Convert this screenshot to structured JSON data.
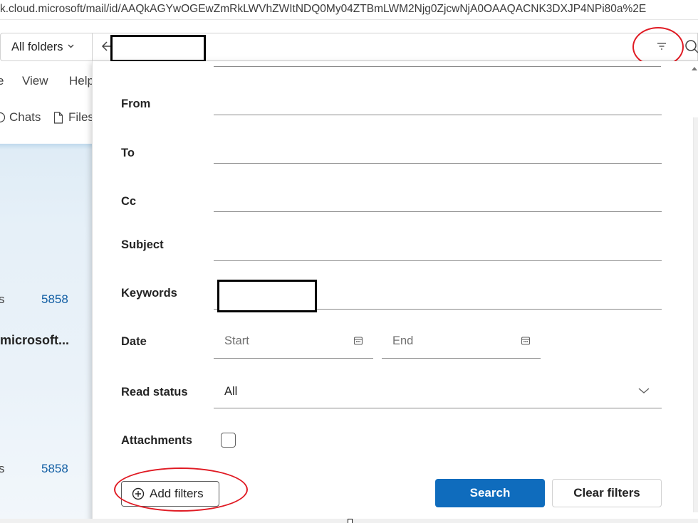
{
  "browser": {
    "url": "k.cloud.microsoft/mail/id/AAQkAGYwOGEwZmRkLWVhZWItNDQ0My04ZTBmLWM2Njg0ZjcwNjA0OAAQACNK3DXJP4NPi80a%2E"
  },
  "toolbar": {
    "folder_scope": "All folders"
  },
  "menu": {
    "items": [
      "e",
      "View",
      "Help"
    ]
  },
  "app_tabs": {
    "chats": "Chats",
    "files": "Files"
  },
  "mail_list": {
    "rows": [
      {
        "cut": "s",
        "count": "5858"
      },
      {
        "sender": "microsoft..."
      },
      {
        "cut": "s",
        "count": "5858"
      }
    ]
  },
  "filter_panel": {
    "fields": {
      "from": {
        "label": "From",
        "value": ""
      },
      "to": {
        "label": "To",
        "value": ""
      },
      "cc": {
        "label": "Cc",
        "value": ""
      },
      "subject": {
        "label": "Subject",
        "value": ""
      },
      "keywords": {
        "label": "Keywords",
        "value": ""
      },
      "date": {
        "label": "Date",
        "start_placeholder": "Start",
        "end_placeholder": "End"
      },
      "read_status": {
        "label": "Read status",
        "value": "All"
      },
      "attachments": {
        "label": "Attachments",
        "checked": false
      }
    },
    "buttons": {
      "add_filters": "Add filters",
      "search": "Search",
      "clear_filters": "Clear filters"
    }
  },
  "icons": {
    "back": "arrow-left-icon",
    "filter": "filter-icon",
    "search": "search-icon",
    "calendar": "calendar-icon",
    "chevron": "chevron-down-icon",
    "add": "add-circle-icon",
    "chats": "chat-icon",
    "files": "file-icon"
  },
  "colors": {
    "primary": "#0f6cbd",
    "annotation_red": "#e01b24",
    "count_blue": "#115ea3"
  }
}
